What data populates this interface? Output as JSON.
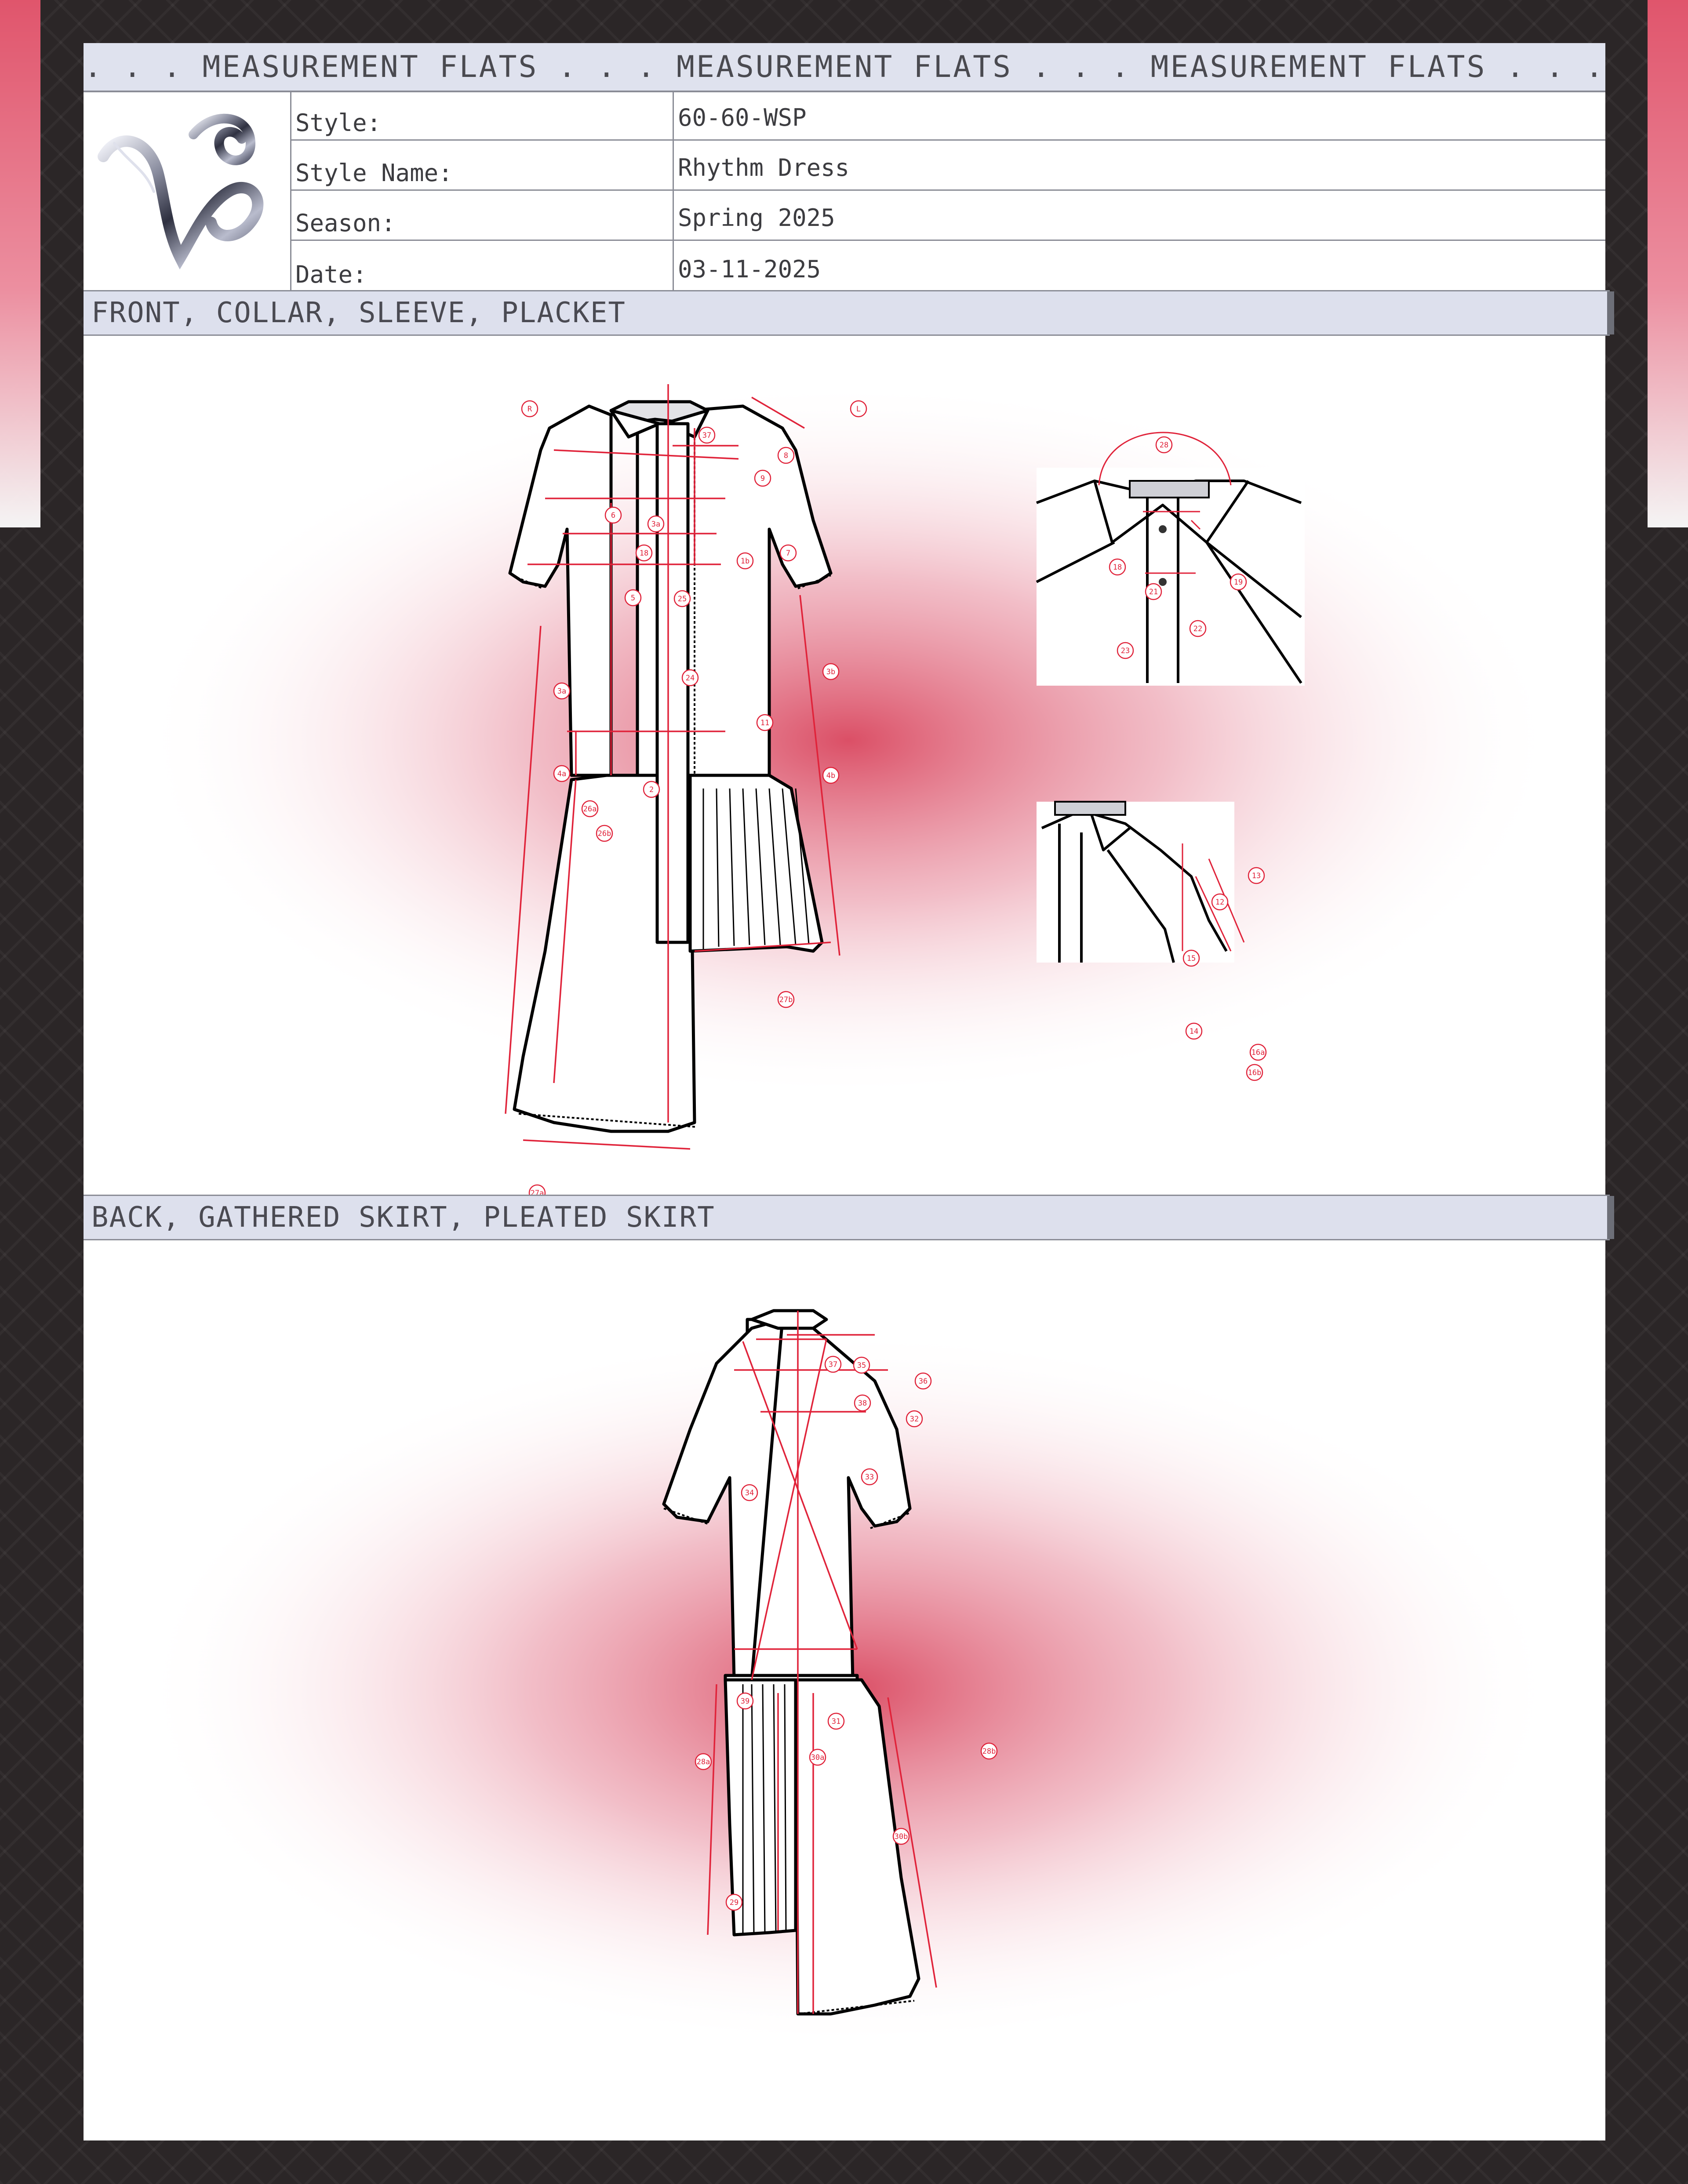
{
  "banner": {
    "text": ". . . MEASUREMENT FLATS . . . MEASUREMENT FLATS . . . MEASUREMENT FLATS . . ."
  },
  "spec": {
    "rows": [
      {
        "label": "Style:",
        "value": "60-60-WSP"
      },
      {
        "label": "Style Name:",
        "value": "Rhythm Dress"
      },
      {
        "label": "Season:",
        "value": "Spring 2025"
      },
      {
        "label": "Date:",
        "value": "03-11-2025"
      }
    ]
  },
  "sections": {
    "front_title": "FRONT, COLLAR, SLEEVE, PLACKET",
    "back_title": "BACK, GATHERED SKIRT, PLEATED SKIRT"
  },
  "colors": {
    "accent_red": "#e0233a",
    "glow": "#d9465e",
    "header_fill": "#dfe2ee",
    "border": "#8a8c96"
  },
  "callouts": {
    "front": [
      "R",
      "L",
      "37",
      "8",
      "9",
      "6",
      "3a",
      "18",
      "1b",
      "7",
      "5",
      "25",
      "3b",
      "24",
      "3a",
      "11",
      "4a",
      "4b",
      "2",
      "26a",
      "26b",
      "27b",
      "27a"
    ],
    "collar": [
      "28",
      "18",
      "19",
      "21",
      "22",
      "23"
    ],
    "sleeve": [
      "13",
      "12",
      "15",
      "14",
      "16a",
      "16b"
    ],
    "back": [
      "37",
      "35",
      "36",
      "38",
      "32",
      "33",
      "34",
      "39",
      "31",
      "28a",
      "28b",
      "30a",
      "30b",
      "29"
    ]
  }
}
